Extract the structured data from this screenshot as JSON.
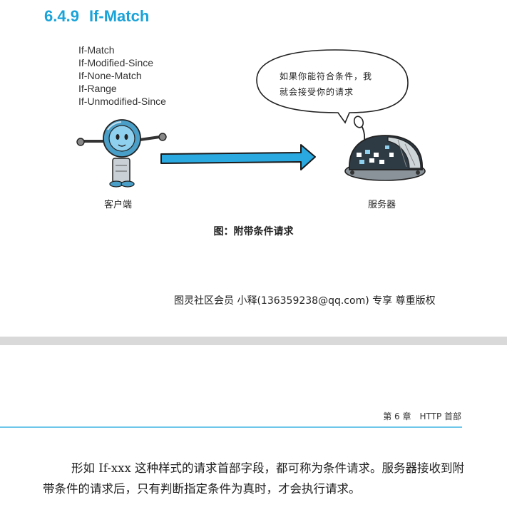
{
  "section": {
    "number": "6.4.9",
    "title": "If-Match"
  },
  "figure": {
    "header_fields": [
      "If-Match",
      "If-Modified-Since",
      "If-None-Match",
      "If-Range",
      "If-Unmodified-Since"
    ],
    "speech_bubble_lines": [
      "如果你能符合条件，我",
      "就会接受你的请求"
    ],
    "client_label": "客户端",
    "server_label": "服务器",
    "caption": "图：附带条件请求",
    "colors": {
      "accent": "#1aa3d9",
      "arrow": "#2aa8e0",
      "robot_body": "#4a9fc8",
      "server_dark": "#2e3a44"
    }
  },
  "watermark": "图灵社区会员 小释(136359238@qq.com) 专享 尊重版权",
  "page_header": {
    "chapter": "第 6 章　HTTP 首部"
  },
  "body": {
    "paragraph": "形如 If-xxx 这种样式的请求首部字段，都可称为条件请求。服务器接收到附带条件的请求后，只有判断指定条件为真时，才会执行请求。"
  }
}
